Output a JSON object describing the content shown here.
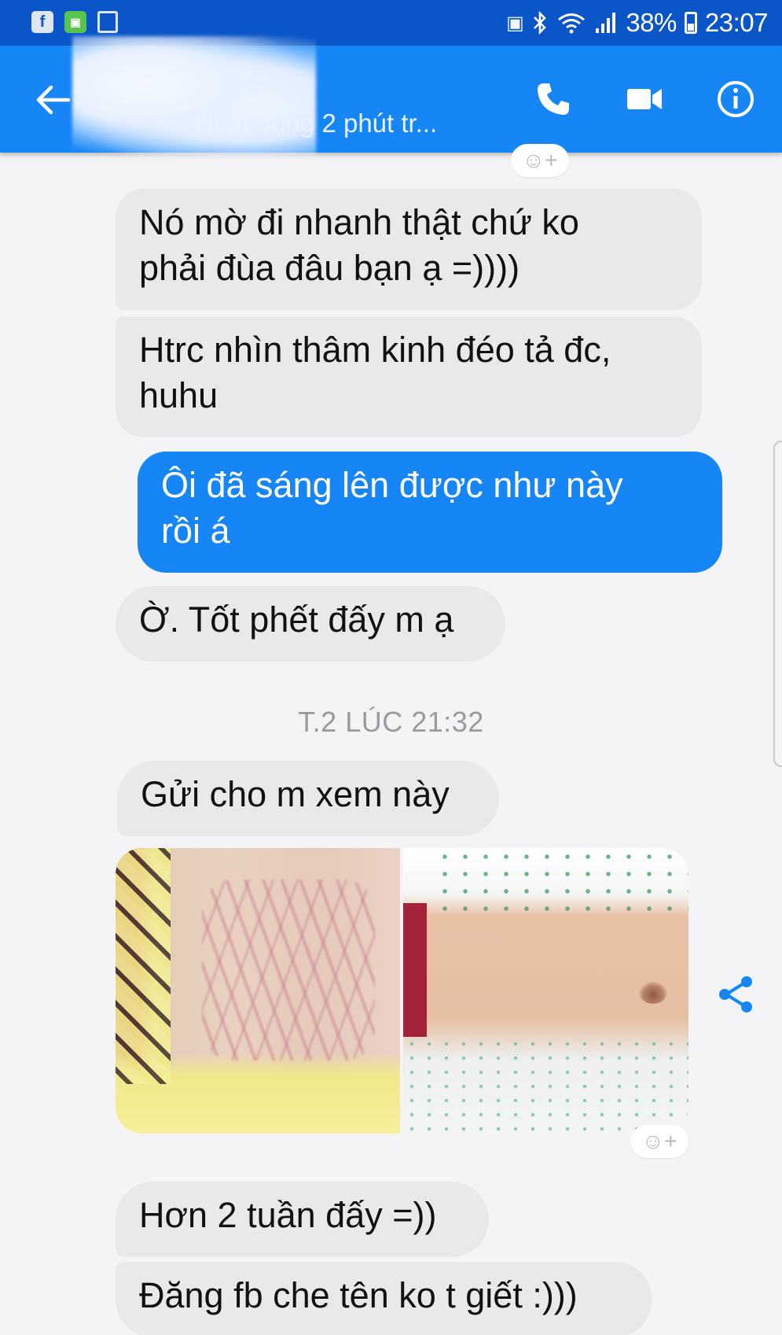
{
  "status_bar": {
    "battery": "38%",
    "time": "23:07",
    "left_icons": [
      "facebook-icon",
      "green-app-icon",
      "document-icon"
    ],
    "right_icons": [
      "battery-saver-icon",
      "bluetooth-icon",
      "wifi-icon",
      "signal-icon"
    ]
  },
  "header": {
    "contact_status": "Hoạt động 2 phút tr...",
    "contact_name_obscured": true,
    "colors": {
      "bar": "#1686f7",
      "status_bar": "#0a56c8"
    }
  },
  "messages": [
    {
      "direction": "incoming",
      "lines": [
        "Nó mờ đi nhanh thật chứ ko",
        "phải đùa đâu bạn ạ =))))"
      ]
    },
    {
      "direction": "incoming",
      "lines": [
        "Htrc nhìn thâm kinh đéo tả đc,",
        "huhu"
      ]
    },
    {
      "direction": "outgoing",
      "lines": [
        "Ôi đã sáng lên được như này",
        "rồi á"
      ]
    },
    {
      "direction": "incoming",
      "lines": [
        "Ờ. Tốt phết đấy m ạ"
      ]
    },
    {
      "direction": "incoming",
      "lines": [
        "Gửi cho m xem này"
      ]
    },
    {
      "direction": "incoming",
      "lines": [
        "Hơn 2 tuần đấy =))"
      ]
    },
    {
      "direction": "incoming",
      "lines": [
        "Đăng fb che tên ko t giết :)))"
      ]
    }
  ],
  "timestamp": "T.2 LÚC 21:32",
  "reaction_glyph": "☺+"
}
